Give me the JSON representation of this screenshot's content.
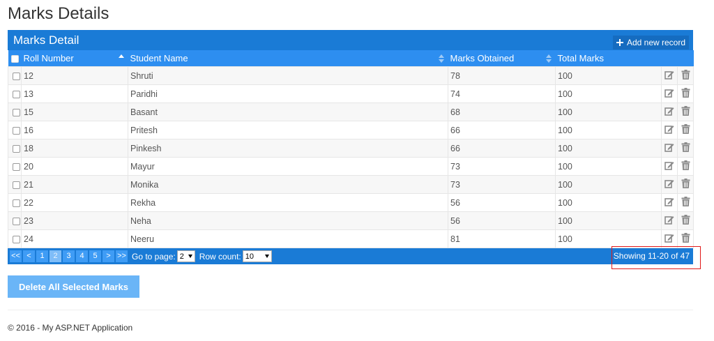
{
  "page": {
    "title": "Marks Details"
  },
  "panel": {
    "title": "Marks Detail",
    "add_label": "Add new record"
  },
  "columns": [
    "Roll Number",
    "Student Name",
    "Marks Obtained",
    "Total Marks"
  ],
  "rows": [
    {
      "roll": "12",
      "name": "Shruti",
      "marks": "78",
      "total": "100"
    },
    {
      "roll": "13",
      "name": "Paridhi",
      "marks": "74",
      "total": "100"
    },
    {
      "roll": "15",
      "name": "Basant",
      "marks": "68",
      "total": "100"
    },
    {
      "roll": "16",
      "name": "Pritesh",
      "marks": "66",
      "total": "100"
    },
    {
      "roll": "18",
      "name": "Pinkesh",
      "marks": "66",
      "total": "100"
    },
    {
      "roll": "20",
      "name": "Mayur",
      "marks": "73",
      "total": "100"
    },
    {
      "roll": "21",
      "name": "Monika",
      "marks": "73",
      "total": "100"
    },
    {
      "roll": "22",
      "name": "Rekha",
      "marks": "56",
      "total": "100"
    },
    {
      "roll": "23",
      "name": "Neha",
      "marks": "56",
      "total": "100"
    },
    {
      "roll": "24",
      "name": "Neeru",
      "marks": "81",
      "total": "100"
    }
  ],
  "pager": {
    "first": "<<",
    "prev": "<",
    "pages": [
      "1",
      "2",
      "3",
      "4",
      "5"
    ],
    "active_page": "2",
    "next": ">",
    "last": ">>",
    "goto_label": "Go to page:",
    "goto_value": "2",
    "rowcount_label": "Row count:",
    "rowcount_value": "10",
    "showing": "Showing 11-20 of 47"
  },
  "actions": {
    "delete_selected": "Delete All Selected Marks"
  },
  "footer": {
    "text": "© 2016 - My ASP.NET Application"
  },
  "icons": {
    "edit": "edit-icon",
    "delete": "trash-icon",
    "add": "plus-icon"
  },
  "colors": {
    "header": "#1a7bd6",
    "subheader": "#2d8ef0",
    "delete_button": "#6ab5f7",
    "highlight": "#e01818"
  }
}
